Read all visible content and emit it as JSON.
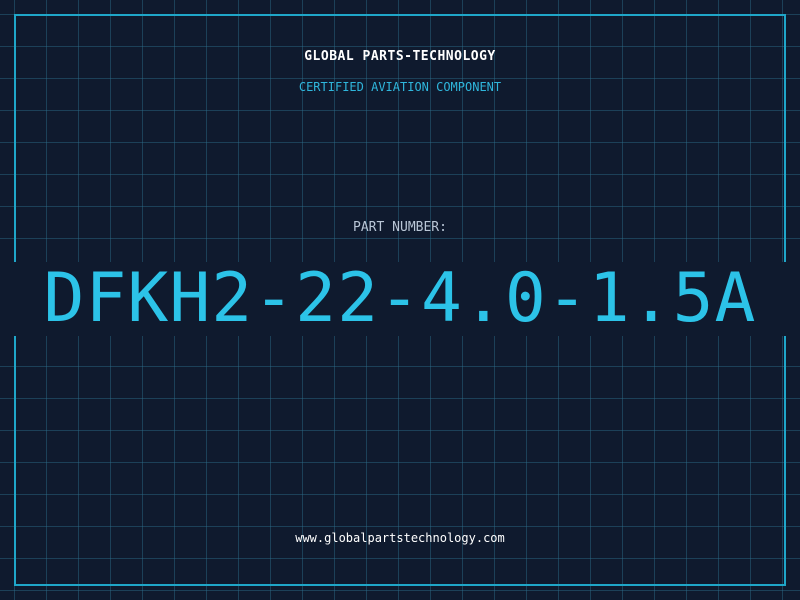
{
  "header": {
    "brand": "GLOBAL PARTS-TECHNOLOGY",
    "subtitle": "CERTIFIED AVIATION COMPONENT"
  },
  "part": {
    "label": "PART NUMBER:",
    "number": "DFKH2-22-4.0-1.5A"
  },
  "footer": {
    "website": "www.globalpartstechnology.com"
  },
  "colors": {
    "background": "#0f1a2e",
    "accent": "#2cc3e8",
    "grid": "#2d6e8c",
    "frame": "#1fa6c9"
  }
}
